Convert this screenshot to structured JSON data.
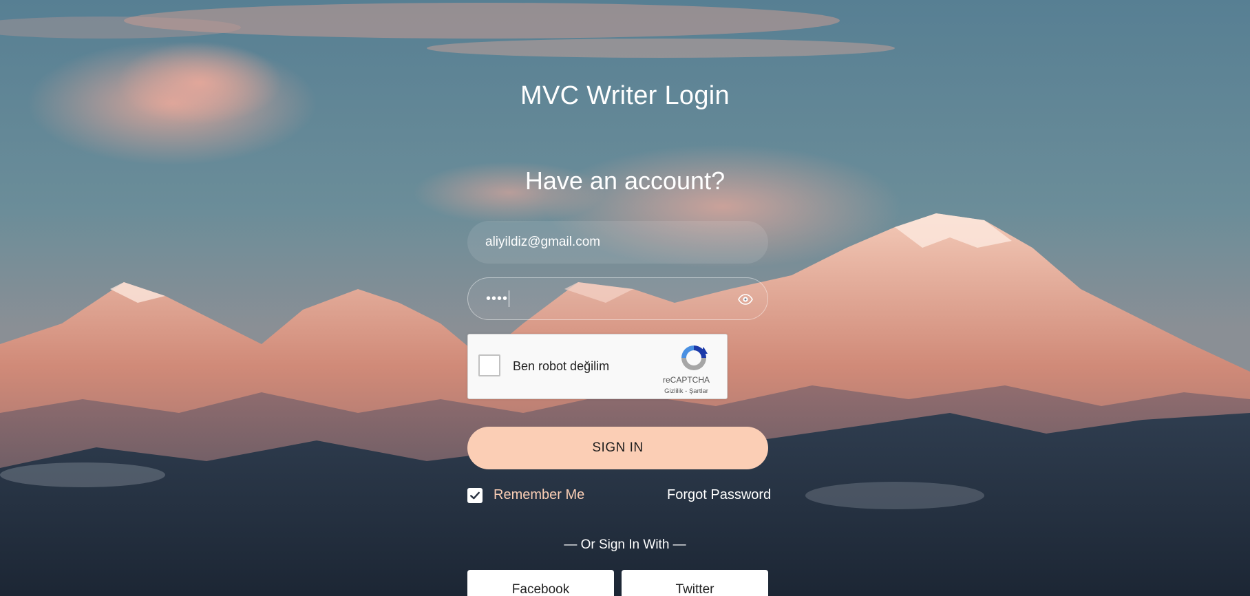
{
  "page": {
    "title": "MVC Writer Login",
    "subtitle": "Have an account?"
  },
  "login_form": {
    "email_value": "aliyildiz@gmail.com",
    "password_masked": "••••",
    "show_password_icon": "eye-icon"
  },
  "recaptcha": {
    "label": "Ben robot değilim",
    "brand": "reCAPTCHA",
    "links": "Gizlilik - Şartlar",
    "checked": false
  },
  "actions": {
    "sign_in_label": "SIGN IN",
    "remember_me_label": "Remember Me",
    "remember_me_checked": true,
    "forgot_password_label": "Forgot Password",
    "or_sign_in_with": "— Or Sign In With —",
    "facebook_label": "Facebook",
    "twitter_label": "Twitter"
  },
  "colors": {
    "accent": "#fbceb5",
    "text": "#ffffff"
  }
}
